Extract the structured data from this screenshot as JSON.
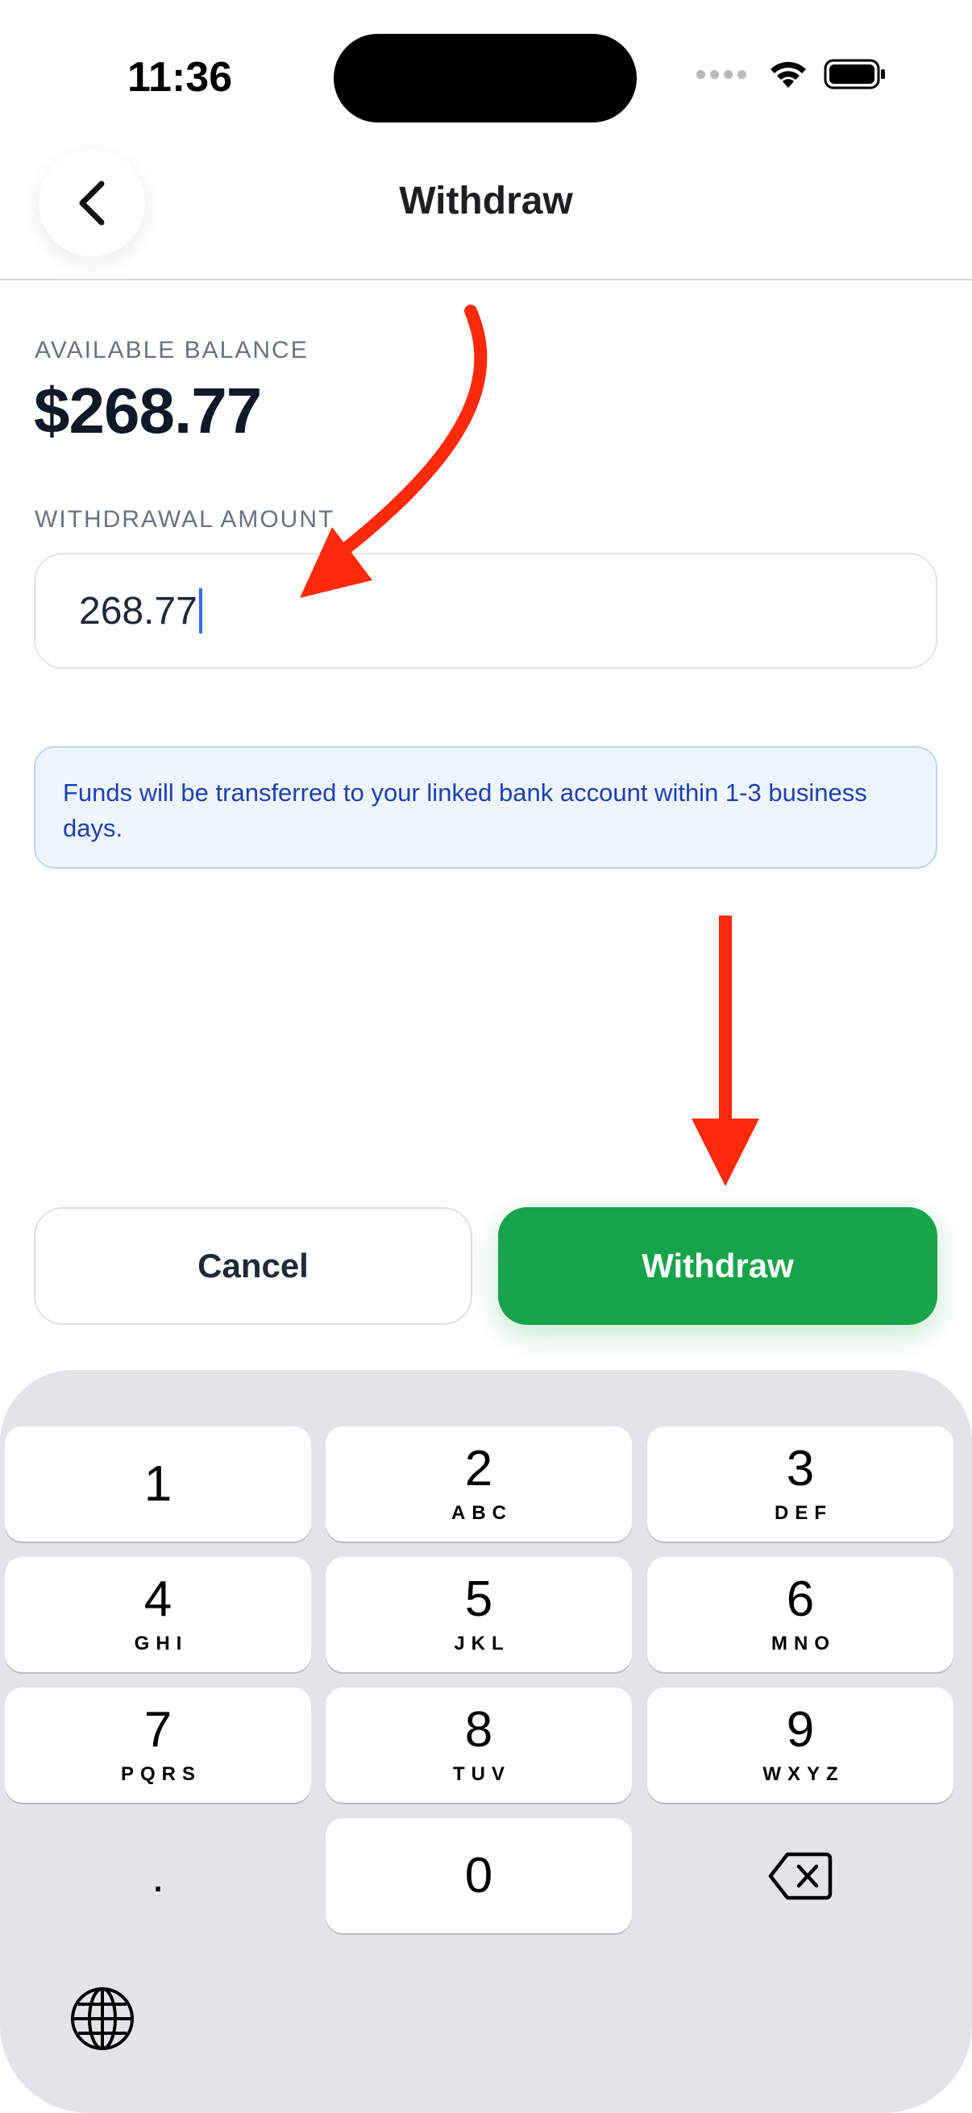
{
  "status_bar": {
    "time": "11:36"
  },
  "header": {
    "title": "Withdraw"
  },
  "balance": {
    "label": "AVAILABLE BALANCE",
    "value": "$268.77"
  },
  "amount": {
    "label": "WITHDRAWAL AMOUNT",
    "value": "268.77"
  },
  "info": {
    "text": "Funds will be transferred to your linked bank account within 1-3 business days."
  },
  "actions": {
    "cancel": "Cancel",
    "withdraw": "Withdraw"
  },
  "keyboard": {
    "keys": [
      {
        "num": "1",
        "letters": ""
      },
      {
        "num": "2",
        "letters": "ABC"
      },
      {
        "num": "3",
        "letters": "DEF"
      },
      {
        "num": "4",
        "letters": "GHI"
      },
      {
        "num": "5",
        "letters": "JKL"
      },
      {
        "num": "6",
        "letters": "MNO"
      },
      {
        "num": "7",
        "letters": "PQRS"
      },
      {
        "num": "8",
        "letters": "TUV"
      },
      {
        "num": "9",
        "letters": "WXYZ"
      },
      {
        "num": ".",
        "letters": ""
      },
      {
        "num": "0",
        "letters": ""
      }
    ]
  },
  "colors": {
    "accent_green": "#16a34a",
    "info_bg": "#eef5fe",
    "info_text": "#1e40af",
    "arrow_red": "#ff2a0c"
  }
}
